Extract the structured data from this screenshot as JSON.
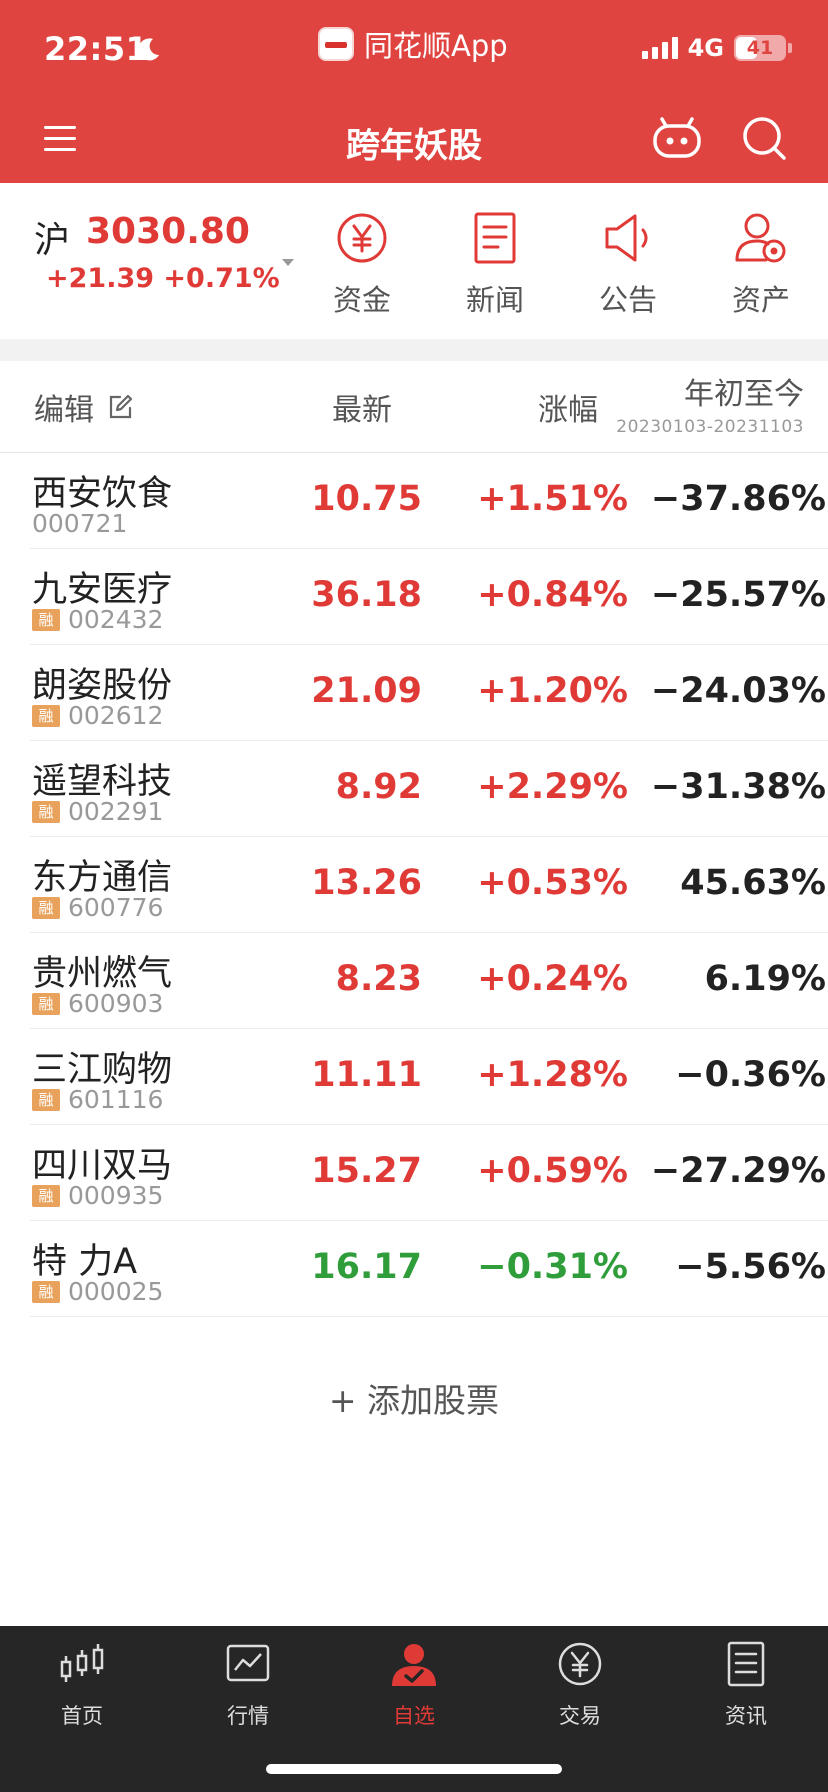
{
  "status_bar": {
    "time": "22:51",
    "app_name": "同花顺App",
    "network": "4G",
    "battery": "41"
  },
  "nav": {
    "title": "跨年妖股"
  },
  "index": {
    "name": "沪",
    "value": "3030.80",
    "change": "+21.39 +0.71%"
  },
  "quick_actions": [
    {
      "label": "资金",
      "icon": "yuan-circle-icon"
    },
    {
      "label": "新闻",
      "icon": "document-icon"
    },
    {
      "label": "公告",
      "icon": "speaker-icon"
    },
    {
      "label": "资产",
      "icon": "user-assets-icon"
    }
  ],
  "table": {
    "headers": {
      "edit": "编辑",
      "latest": "最新",
      "change": "涨幅",
      "ytd": "年初至今",
      "ytd_range": "20230103-20231103"
    },
    "rows": [
      {
        "name": "西安饮食",
        "code": "000721",
        "tag": "",
        "price": "10.75",
        "change": "+1.51%",
        "ytd": "−37.86%"
      },
      {
        "name": "九安医疗",
        "code": "002432",
        "tag": "融",
        "price": "36.18",
        "change": "+0.84%",
        "ytd": "−25.57%"
      },
      {
        "name": "朗姿股份",
        "code": "002612",
        "tag": "融",
        "price": "21.09",
        "change": "+1.20%",
        "ytd": "−24.03%"
      },
      {
        "name": "遥望科技",
        "code": "002291",
        "tag": "融",
        "price": "8.92",
        "change": "+2.29%",
        "ytd": "−31.38%"
      },
      {
        "name": "东方通信",
        "code": "600776",
        "tag": "融",
        "price": "13.26",
        "change": "+0.53%",
        "ytd": "45.63%"
      },
      {
        "name": "贵州燃气",
        "code": "600903",
        "tag": "融",
        "price": "8.23",
        "change": "+0.24%",
        "ytd": "6.19%"
      },
      {
        "name": "三江购物",
        "code": "601116",
        "tag": "融",
        "price": "11.11",
        "change": "+1.28%",
        "ytd": "−0.36%"
      },
      {
        "name": "四川双马",
        "code": "000935",
        "tag": "融",
        "price": "15.27",
        "change": "+0.59%",
        "ytd": "−27.29%"
      },
      {
        "name": "特 力A",
        "code": "000025",
        "tag": "融",
        "price": "16.17",
        "change": "−0.31%",
        "ytd": "−5.56%"
      }
    ]
  },
  "add_stock_label": "+ 添加股票",
  "tabs": [
    {
      "label": "首页",
      "icon": "candlestick-icon"
    },
    {
      "label": "行情",
      "icon": "chart-icon"
    },
    {
      "label": "自选",
      "icon": "user-star-icon"
    },
    {
      "label": "交易",
      "icon": "yuan-circle-icon"
    },
    {
      "label": "资讯",
      "icon": "news-icon"
    }
  ],
  "colors": {
    "brand_red": "#e04441",
    "up": "#e03a37",
    "down": "#2e9d3a",
    "tabbar_bg": "#262626"
  }
}
